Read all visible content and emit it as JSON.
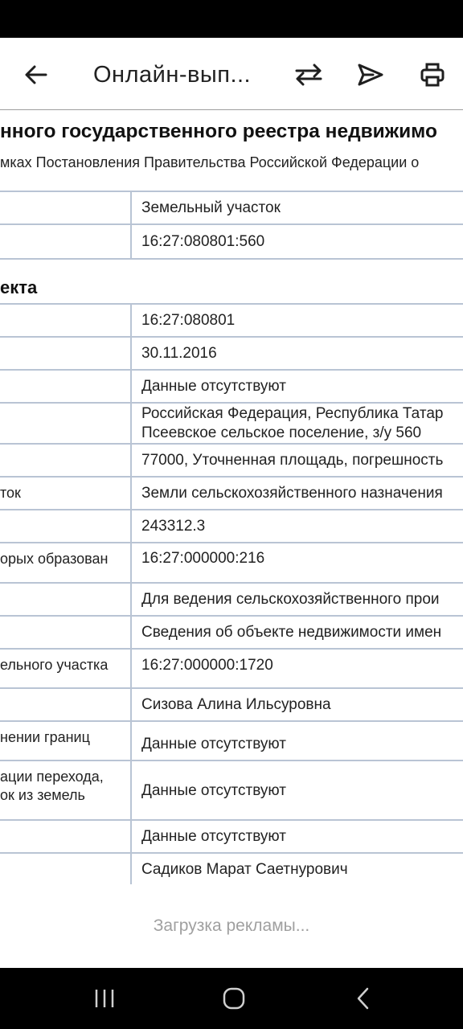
{
  "app_bar": {
    "title": "Онлайн-вып..."
  },
  "document": {
    "title": "нного государственного реестра недвижимо",
    "subtitle": "мках Постановления Правительства Российской Федерации о",
    "section_heading": "екта",
    "rows_top": [
      {
        "label": "",
        "value": "Земельный участок"
      },
      {
        "label": "",
        "value": "16:27:080801:560"
      }
    ],
    "rows": [
      {
        "label": "",
        "value": "16:27:080801"
      },
      {
        "label": "",
        "value": "30.11.2016"
      },
      {
        "label": "",
        "value": "Данные отсутствуют"
      },
      {
        "label": "",
        "value": "Российская Федерация, Республика Татар",
        "value2": "Псеевское сельское поселение, з/у 560"
      },
      {
        "label": "",
        "value": "77000, Уточненная площадь, погрешность"
      },
      {
        "label": "ток",
        "value": "Земли сельскохозяйственного назначения"
      },
      {
        "label": "",
        "value": "243312.3"
      },
      {
        "label": "орых образован",
        "value": "16:27:000000:216"
      },
      {
        "label": "",
        "value": "Для ведения сельскохозяйственного прои"
      },
      {
        "label": "",
        "value": "Сведения об объекте недвижимости имен"
      },
      {
        "label": "ельного участка",
        "value": "16:27:000000:1720"
      },
      {
        "label": "",
        "value": "Сизова Алина Ильсуровна"
      },
      {
        "label": "нении границ",
        "value": "Данные отсутствуют"
      },
      {
        "label": "ации перехода,",
        "label2": "ок из земель",
        "value": "Данные отсутствуют"
      },
      {
        "label": "",
        "value": "Данные отсутствуют"
      },
      {
        "label": "",
        "value": "Садиков Марат Саетнурович"
      }
    ]
  },
  "ad": {
    "loading_text": "Загрузка рекламы..."
  },
  "icons": {
    "back": "arrow-left-icon",
    "swap": "swap-arrows-icon",
    "send": "send-icon",
    "print": "printer-icon",
    "recents": "recents-icon",
    "home": "home-icon",
    "nav_back": "chevron-left-icon"
  }
}
